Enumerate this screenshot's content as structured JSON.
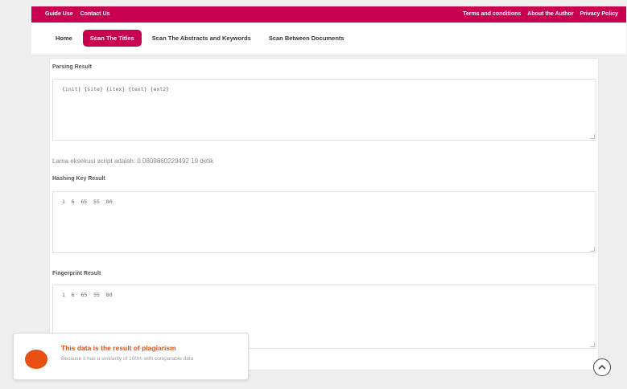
{
  "topbar": {
    "left_links": [
      "Guide Use",
      "Contact Us"
    ],
    "right_links": [
      "Terms and conditions",
      "About the Author",
      "Privacy Policy"
    ]
  },
  "nav": {
    "items": [
      "Home",
      "Scan The Titles",
      "Scan The Abstracts and Keywords",
      "Scan Between Documents"
    ],
    "active": "Scan The Titles"
  },
  "parsing": {
    "label": "Parsing Result",
    "value": "{init} {site} {itex} {text} {ext2}"
  },
  "execution_time": "Lama eksekusi script adalah: 0.0809860229492 19 detik",
  "hashing": {
    "label": "Hashing Key Result",
    "value": "1  6  65  55  80"
  },
  "fingerprint": {
    "label": "Fingerprint Result",
    "value": "1  6  65  55  80"
  },
  "toast": {
    "title": "This data is the result of plagiarism",
    "message": "Because it has a similarity of 100% with comparable data"
  },
  "colors": {
    "brand": "#c8004f",
    "alert": "#e84f12"
  }
}
